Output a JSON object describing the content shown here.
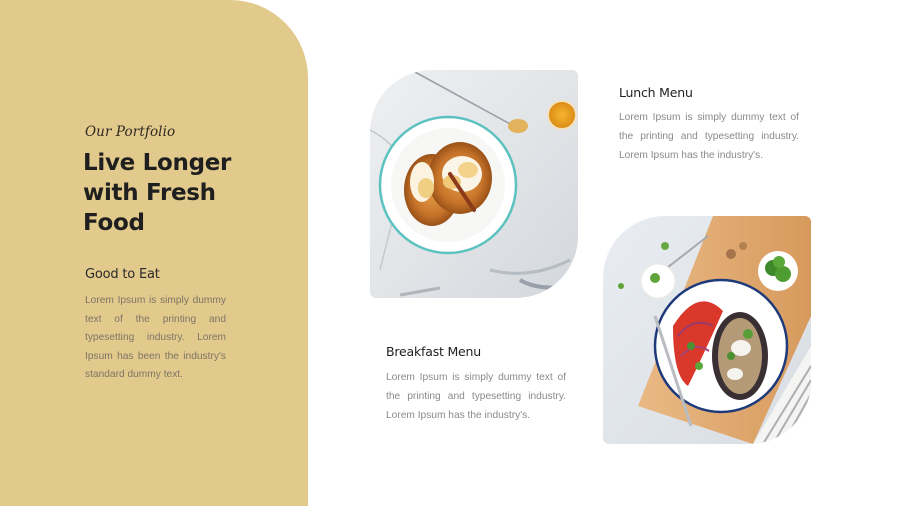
{
  "theme": {
    "panel_color": "#e2c98c",
    "heading_color": "#1f1f1f",
    "body_text_color": "#8a8a8a"
  },
  "portfolio": {
    "eyebrow": "Our Portfolio",
    "headline": "Live Longer with Fresh Food",
    "sub_heading": "Good to Eat",
    "body": "Lorem Ipsum is simply dummy text of the printing and typesetting industry. Lorem Ipsum has been the industry's standard dummy text."
  },
  "menus": [
    {
      "title": "Lunch Menu",
      "body": "Lorem Ipsum is simply dummy text of the printing and typesetting industry. Lorem Ipsum has the industry's.",
      "image": "salad-plate-photo"
    },
    {
      "title": "Breakfast Menu",
      "body": "Lorem Ipsum is simply dummy text of the printing and typesetting industry. Lorem Ipsum has the industry's.",
      "image": "pancakes-photo"
    }
  ]
}
